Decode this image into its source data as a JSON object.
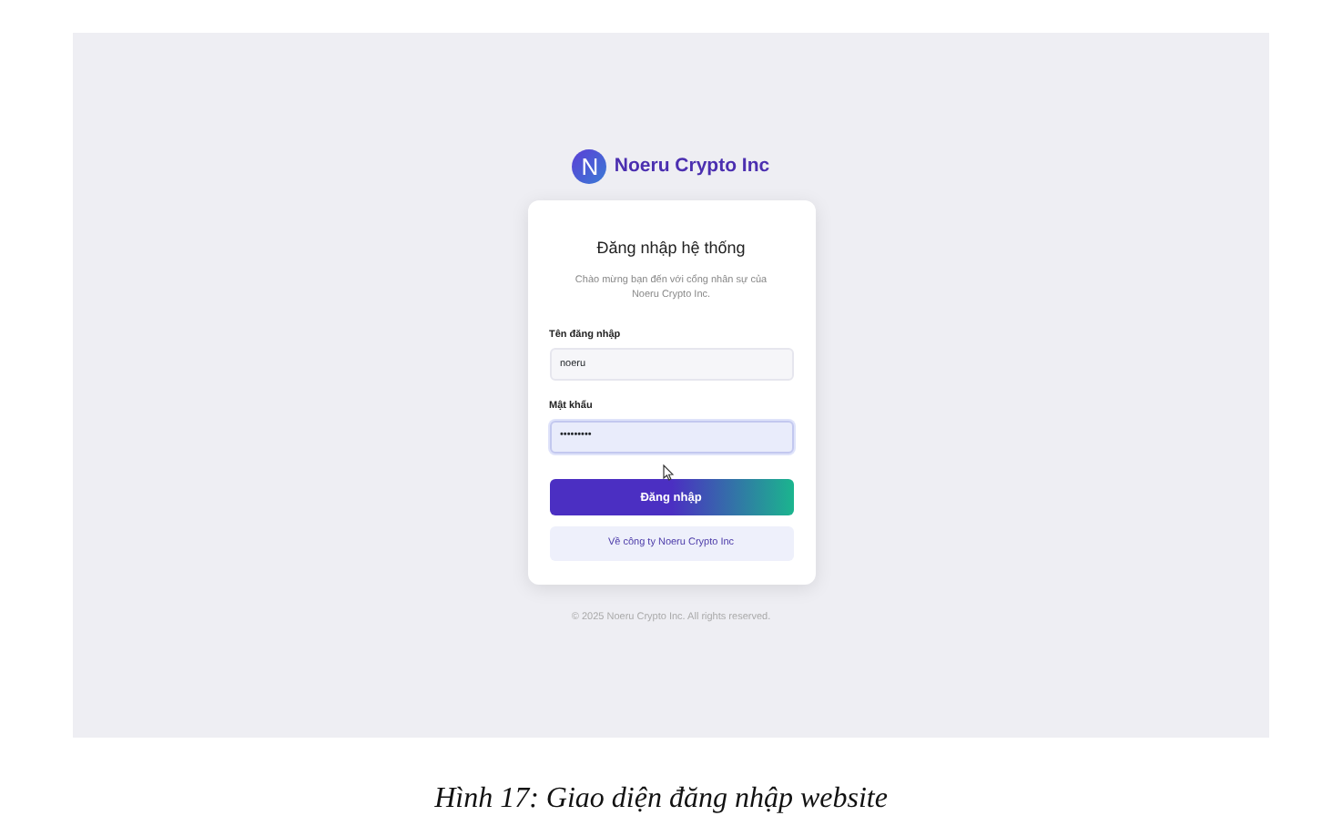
{
  "brand": {
    "logo_letter": "N",
    "name": "Noeru Crypto Inc"
  },
  "login_card": {
    "title": "Đăng nhập hệ thống",
    "subtitle": "Chào mừng bạn đến với cổng nhân sự của Noeru Crypto Inc.",
    "fields": [
      {
        "label": "Tên đăng nhập",
        "value": "noeru",
        "focused": false
      },
      {
        "label": "Mật khẩu",
        "value": "•••••••••",
        "focused": true
      }
    ],
    "submit_button": "Đăng nhập",
    "about_button": "Về công ty Noeru Crypto Inc"
  },
  "footer": "© 2025 Noeru Crypto Inc. All rights reserved.",
  "caption": "Hình 17: Giao diện đăng nhập website"
}
